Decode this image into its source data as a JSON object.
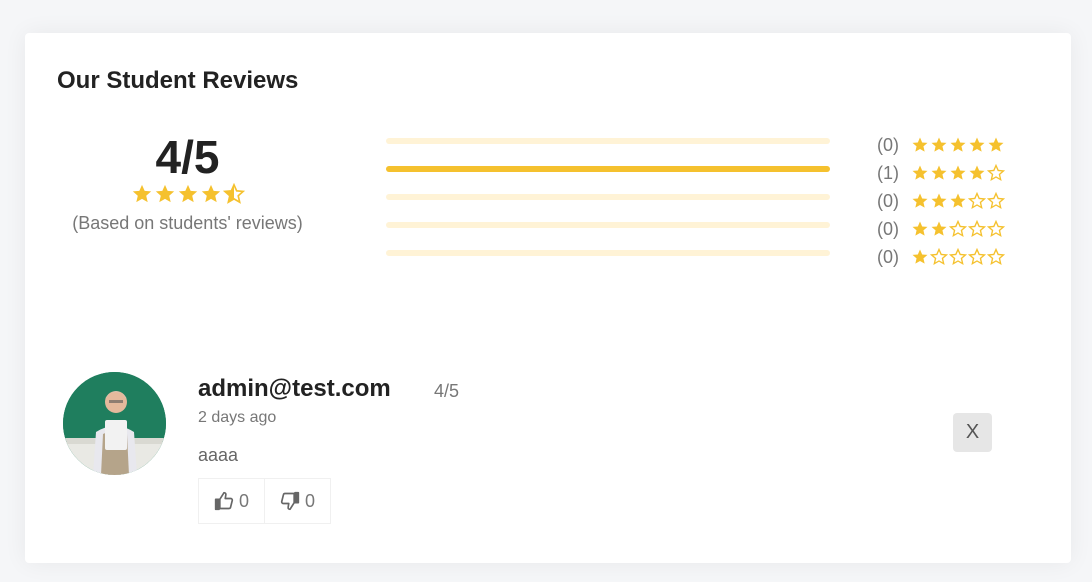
{
  "section": {
    "title": "Our Student Reviews"
  },
  "summary": {
    "score": "4/5",
    "rating": 4.5,
    "basis": "(Based on students' reviews)"
  },
  "breakdown": [
    {
      "stars": 5,
      "count": "(0)",
      "fraction": 0
    },
    {
      "stars": 4,
      "count": "(1)",
      "fraction": 1
    },
    {
      "stars": 3,
      "count": "(0)",
      "fraction": 0
    },
    {
      "stars": 2,
      "count": "(0)",
      "fraction": 0
    },
    {
      "stars": 1,
      "count": "(0)",
      "fraction": 0
    }
  ],
  "review": {
    "author": "admin@test.com",
    "rating": "4/5",
    "time": "2 days ago",
    "text": "aaaa",
    "likes": "0",
    "dislikes": "0",
    "delete_label": "X"
  },
  "colors": {
    "star": "#f5c12e",
    "bar_track": "#fff3d6",
    "bar_fill": "#f5c12e"
  }
}
